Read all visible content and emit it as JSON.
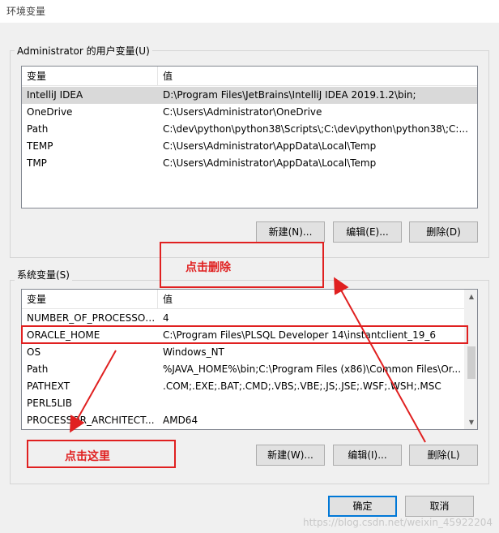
{
  "window": {
    "title": "环境变量"
  },
  "user_vars": {
    "group_label": "Administrator 的用户变量(U)",
    "columns": {
      "name": "变量",
      "value": "值"
    },
    "rows": [
      {
        "name": "IntelliJ IDEA",
        "value": "D:\\Program Files\\JetBrains\\IntelliJ IDEA 2019.1.2\\bin;"
      },
      {
        "name": "OneDrive",
        "value": "C:\\Users\\Administrator\\OneDrive"
      },
      {
        "name": "Path",
        "value": "C:\\dev\\python\\python38\\Scripts\\;C:\\dev\\python\\python38\\;C:..."
      },
      {
        "name": "TEMP",
        "value": "C:\\Users\\Administrator\\AppData\\Local\\Temp"
      },
      {
        "name": "TMP",
        "value": "C:\\Users\\Administrator\\AppData\\Local\\Temp"
      }
    ],
    "buttons": {
      "new": "新建(N)...",
      "edit": "编辑(E)...",
      "delete": "删除(D)"
    }
  },
  "system_vars": {
    "group_label": "系统变量(S)",
    "columns": {
      "name": "变量",
      "value": "值"
    },
    "rows": [
      {
        "name": "NUMBER_OF_PROCESSORS",
        "value": "4"
      },
      {
        "name": "ORACLE_HOME",
        "value": "C:\\Program Files\\PLSQL Developer 14\\instantclient_19_6"
      },
      {
        "name": "OS",
        "value": "Windows_NT"
      },
      {
        "name": "Path",
        "value": "%JAVA_HOME%\\bin;C:\\Program Files (x86)\\Common Files\\Or..."
      },
      {
        "name": "PATHEXT",
        "value": ".COM;.EXE;.BAT;.CMD;.VBS;.VBE;.JS;.JSE;.WSF;.WSH;.MSC"
      },
      {
        "name": "PERL5LIB",
        "value": ""
      },
      {
        "name": "PROCESSOR_ARCHITECT...",
        "value": "AMD64"
      }
    ],
    "buttons": {
      "new": "新建(W)...",
      "edit": "编辑(I)...",
      "delete": "删除(L)"
    }
  },
  "dialog_buttons": {
    "ok": "确定",
    "cancel": "取消"
  },
  "annotations": {
    "click_delete": "点击删除",
    "click_here": "点击这里"
  },
  "watermark": "https://blog.csdn.net/weixin_45922204",
  "colors": {
    "annotation_red": "#e02020",
    "selection": "#d9d9d9",
    "focus_blue": "#0078d7"
  },
  "icons": {
    "scroll_up": "chevron-up-icon",
    "scroll_down": "chevron-down-icon"
  }
}
